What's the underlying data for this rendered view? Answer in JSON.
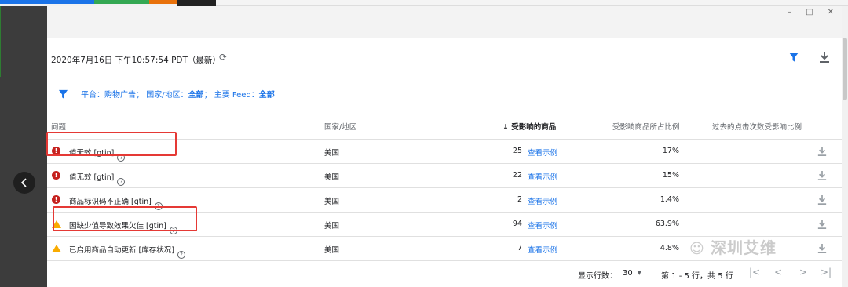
{
  "header": {
    "timestamp": "2020年7月16日 下午10:57:54 PDT（最新）"
  },
  "filter": {
    "platform_label": "平台：",
    "platform_value": "购物广告",
    "country_label": "国家/地区：",
    "country_value": "全部",
    "feed_label": "主要 Feed：",
    "feed_value": "全部"
  },
  "columns": {
    "issue": "问题",
    "country": "国家/地区",
    "affected_products": "受影响的商品",
    "affected_ratio": "受影响商品所占比例",
    "click_ratio": "过去的点击次数受影响比例"
  },
  "rows": [
    {
      "issue": "值无效 [gtin]",
      "country": "美国",
      "count": "25",
      "link": "查看示例",
      "ratio": "17%",
      "severity": "error"
    },
    {
      "issue": "值无效 [gtin]",
      "country": "美国",
      "count": "22",
      "link": "查看示例",
      "ratio": "15%",
      "severity": "error"
    },
    {
      "issue": "商品标识码不正确 [gtin]",
      "country": "美国",
      "count": "2",
      "link": "查看示例",
      "ratio": "1.4%",
      "severity": "error"
    },
    {
      "issue": "因缺少值导致效果欠佳 [gtin]",
      "country": "美国",
      "count": "94",
      "link": "查看示例",
      "ratio": "63.9%",
      "severity": "warning"
    },
    {
      "issue": "已启用商品自动更新 [库存状况]",
      "country": "美国",
      "count": "7",
      "link": "查看示例",
      "ratio": "4.8%",
      "severity": "warning"
    }
  ],
  "footer": {
    "rows_label": "显示行数：",
    "rows_value": "30",
    "range": "第 1 - 5 行，共 5 行"
  },
  "watermark": "深圳艾维",
  "colors": {
    "accent": "#1a73e8",
    "error": "#c5221f",
    "warning": "#f9ab00",
    "highlight": "#e53935"
  }
}
